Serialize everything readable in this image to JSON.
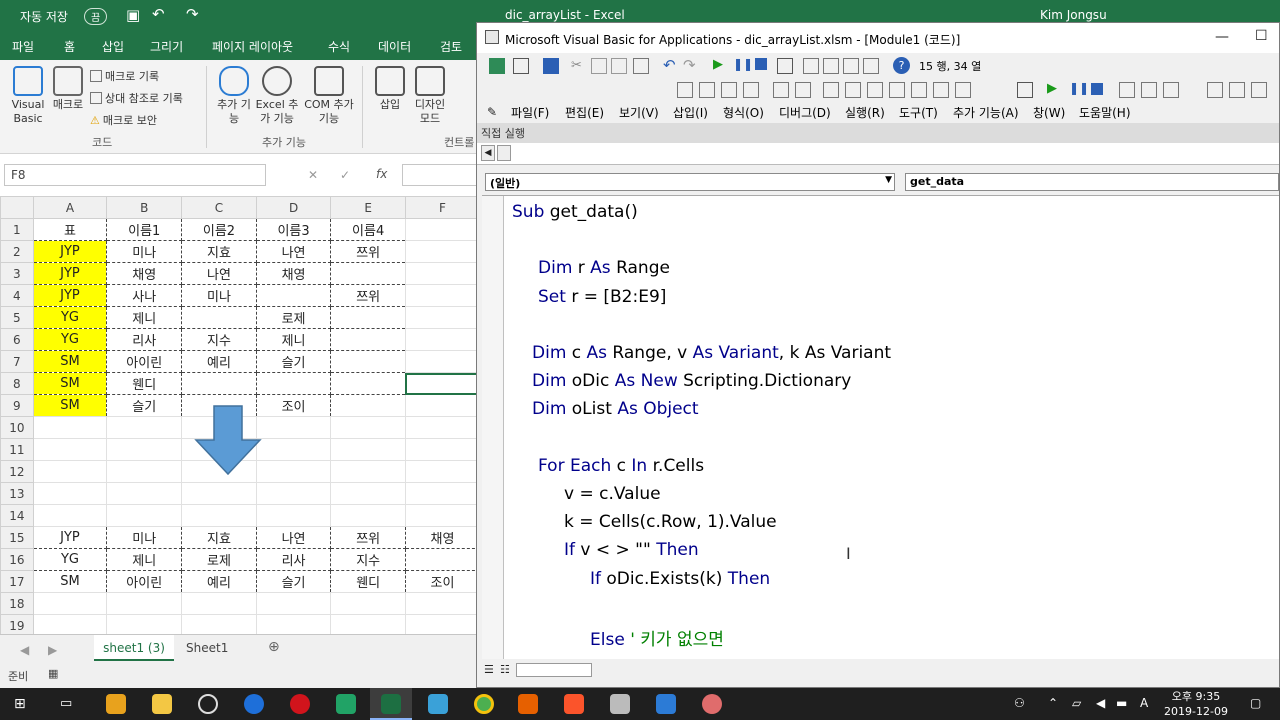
{
  "excel": {
    "title": "dic_arrayList  -  Excel",
    "user": "Kim Jongsu",
    "autosave": "자동 저장",
    "autosave_state": "끔",
    "tabs": [
      "파일",
      "홈",
      "삽입",
      "그리기",
      "페이지 레이아웃",
      "수식",
      "데이터",
      "검토"
    ],
    "ribbon": {
      "visual_basic": "Visual Basic",
      "macro": "매크로",
      "record_macro": "매크로 기록",
      "relative_ref": "상대 참조로 기록",
      "macro_security": "매크로 보안",
      "group_code": "코드",
      "add_in": "추가 기능",
      "excel_add_in": "Excel 추가 기능",
      "com_add_in": "COM 추가 기능",
      "group_addins": "추가 기능",
      "insert": "삽입",
      "design_mode": "디자인 모드",
      "group_controls": "컨트롤"
    },
    "namebox": "F8",
    "fx": "fx",
    "columns": [
      "A",
      "B",
      "C",
      "D",
      "E",
      "F"
    ],
    "rows": [
      [
        "표",
        "이름1",
        "이름2",
        "이름3",
        "이름4",
        ""
      ],
      [
        "JYP",
        "미나",
        "지효",
        "나연",
        "쯔위",
        ""
      ],
      [
        "JYP",
        "채영",
        "나연",
        "채영",
        "",
        ""
      ],
      [
        "JYP",
        "사나",
        "미나",
        "",
        "쯔위",
        ""
      ],
      [
        "YG",
        "제니",
        "",
        "로제",
        "",
        ""
      ],
      [
        "YG",
        "리사",
        "지수",
        "제니",
        "",
        ""
      ],
      [
        "SM",
        "아이린",
        "예리",
        "슬기",
        "",
        ""
      ],
      [
        "SM",
        "웬디",
        "",
        "",
        "",
        ""
      ],
      [
        "SM",
        "슬기",
        "",
        "조이",
        "",
        ""
      ],
      [
        "",
        "",
        "",
        "",
        "",
        ""
      ],
      [
        "",
        "",
        "",
        "",
        "",
        ""
      ],
      [
        "",
        "",
        "",
        "",
        "",
        ""
      ],
      [
        "",
        "",
        "",
        "",
        "",
        ""
      ],
      [
        "",
        "",
        "",
        "",
        "",
        ""
      ],
      [
        "JYP",
        "미나",
        "지효",
        "나연",
        "쯔위",
        "채영"
      ],
      [
        "YG",
        "제니",
        "로제",
        "리사",
        "지수",
        ""
      ],
      [
        "SM",
        "아이린",
        "예리",
        "슬기",
        "웬디",
        "조이"
      ],
      [
        "",
        "",
        "",
        "",
        "",
        ""
      ],
      [
        "",
        "",
        "",
        "",
        "",
        ""
      ],
      [
        "",
        "",
        "",
        "",
        "",
        ""
      ]
    ],
    "sheet_tabs": [
      "sheet1 (3)",
      "Sheet1"
    ],
    "status_ready": "준비"
  },
  "vba": {
    "title": "Microsoft Visual Basic for Applications - dic_arrayList.xlsm - [Module1 (코드)]",
    "position": "15 행, 34 열",
    "menu": [
      "파일(F)",
      "편집(E)",
      "보기(V)",
      "삽입(I)",
      "형식(O)",
      "디버그(D)",
      "실행(R)",
      "도구(T)",
      "추가 기능(A)",
      "창(W)",
      "도움말(H)"
    ],
    "immediate_title": "직접 실행",
    "combo_object": "(일반)",
    "combo_proc": "get_data",
    "code": [
      {
        "kw1": "Sub",
        "t1": " get_data()",
        "kw2": "",
        "t2": "",
        "kw3": "",
        "t3": "",
        "cm": ""
      },
      {
        "kw1": "",
        "t1": "",
        "kw2": "",
        "t2": "",
        "kw3": "",
        "t3": "",
        "cm": ""
      },
      {
        "kw1": "Dim",
        "t1": " r ",
        "kw2": "As",
        "t2": " Range",
        "kw3": "",
        "t3": "",
        "cm": ""
      },
      {
        "kw1": "Set",
        "t1": " r = [B2:E9]",
        "kw2": "",
        "t2": "",
        "kw3": "",
        "t3": "",
        "cm": ""
      },
      {
        "kw1": "",
        "t1": "",
        "kw2": "",
        "t2": "",
        "kw3": "",
        "t3": "",
        "cm": ""
      },
      {
        "kw1": "Dim",
        "t1": " c ",
        "kw2": "As",
        "t2": " Range, v ",
        "kw3": "As Variant",
        "t3": ", k As Variant",
        "cm": ""
      },
      {
        "kw1": "Dim",
        "t1": " oDic ",
        "kw2": "As New",
        "t2": " Scripting.Dictionary",
        "kw3": "",
        "t3": "",
        "cm": ""
      },
      {
        "kw1": "Dim",
        "t1": " oList ",
        "kw2": "As Object",
        "t2": "",
        "kw3": "",
        "t3": "",
        "cm": ""
      },
      {
        "kw1": "",
        "t1": "",
        "kw2": "",
        "t2": "",
        "kw3": "",
        "t3": "",
        "cm": ""
      },
      {
        "kw1": "For Each",
        "t1": " c ",
        "kw2": "In",
        "t2": " r.Cells",
        "kw3": "",
        "t3": "",
        "cm": ""
      },
      {
        "kw1": "",
        "t1": "v = c.Value",
        "kw2": "",
        "t2": "",
        "kw3": "",
        "t3": "",
        "cm": ""
      },
      {
        "kw1": "",
        "t1": "k = Cells(c.Row, 1).Value",
        "kw2": "",
        "t2": "",
        "kw3": "",
        "t3": "",
        "cm": ""
      },
      {
        "kw1": "If",
        "t1": " v < > \"\" ",
        "kw2": "Then",
        "t2": "",
        "kw3": "",
        "t3": "",
        "cm": ""
      },
      {
        "kw1": "If",
        "t1": " oDic.Exists(k) ",
        "kw2": "Then",
        "t2": "",
        "kw3": "",
        "t3": "",
        "cm": ""
      },
      {
        "kw1": "",
        "t1": "",
        "kw2": "",
        "t2": "",
        "kw3": "",
        "t3": "",
        "cm": ""
      },
      {
        "kw1": "Else",
        "t1": " ",
        "kw2": "",
        "t2": "",
        "kw3": "",
        "t3": "",
        "cm": "' 키가 없으면"
      }
    ]
  },
  "taskbar": {
    "time": "오후 9:35",
    "date": "2019-12-09"
  },
  "colors": {
    "excel_green": "#217346",
    "highlight_yellow": "#ffff00",
    "arrow_blue": "#5b9bd5",
    "vba_keyword": "#00008b",
    "vba_comment": "#008000"
  }
}
